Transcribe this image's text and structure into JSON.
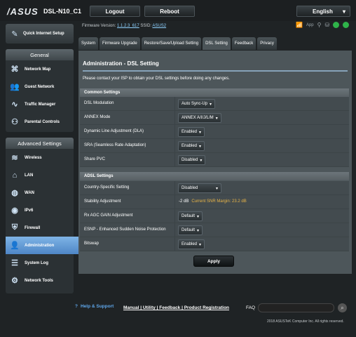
{
  "header": {
    "logo": "/ASUS",
    "model": "DSL-N10_C1",
    "logout_label": "Logout",
    "reboot_label": "Reboot",
    "language": "English"
  },
  "info_bar": {
    "firmware_label": "Firmware Version:",
    "firmware_value": "1.1.2.3_617",
    "ssid_label": "SSID:",
    "ssid_value": "ASUS2",
    "app_label": "App"
  },
  "sidebar": {
    "quick_setup": "Quick Internet Setup",
    "general_title": "General",
    "general_items": [
      {
        "label": "Network Map",
        "icon": "network-map-icon"
      },
      {
        "label": "Guest Network",
        "icon": "guest-network-icon"
      },
      {
        "label": "Traffic Manager",
        "icon": "traffic-manager-icon"
      },
      {
        "label": "Parental Controls",
        "icon": "parental-controls-icon"
      }
    ],
    "advanced_title": "Advanced Settings",
    "advanced_items": [
      {
        "label": "Wireless",
        "icon": "wireless-icon"
      },
      {
        "label": "LAN",
        "icon": "lan-icon"
      },
      {
        "label": "WAN",
        "icon": "wan-icon"
      },
      {
        "label": "IPv6",
        "icon": "ipv6-icon"
      },
      {
        "label": "Firewall",
        "icon": "firewall-icon"
      },
      {
        "label": "Administration",
        "icon": "administration-icon"
      },
      {
        "label": "System Log",
        "icon": "system-log-icon"
      },
      {
        "label": "Network Tools",
        "icon": "network-tools-icon"
      }
    ]
  },
  "tabs": [
    "System",
    "Firmware Upgrade",
    "Restore/Save/Upload Setting",
    "DSL Setting",
    "Feedback",
    "Privacy"
  ],
  "main": {
    "title": "Administration - DSL Setting",
    "description": "Please contact your ISP to obtain your DSL settings before doing any changes.",
    "common_header": "Common Settings",
    "common_rows": [
      {
        "label": "DSL Modulation",
        "value": "Auto Sync-Up"
      },
      {
        "label": "ANNEX Mode",
        "value": "ANNEX A/I/J/L/M"
      },
      {
        "label": "Dynamic Line Adjustment (DLA)",
        "value": "Enabled"
      },
      {
        "label": "SRA (Seamless Rate Adaptation)",
        "value": "Enabled"
      },
      {
        "label": "Share PVC",
        "value": "Disabled"
      }
    ],
    "adsl_header": "ADSL Settings",
    "adsl_rows": [
      {
        "label": "Country-Specific Setting",
        "value": "Disabled"
      },
      {
        "label": "Stability Adjustment",
        "value": "-2 dB",
        "note": "Current SNR Margin: 23.2 dB"
      },
      {
        "label": "Rx AGC GAIN Adjustment",
        "value": "Default"
      },
      {
        "label": "ESNP - Enhanced Sudden Noise Protection",
        "value": "Default"
      },
      {
        "label": "Bitswap",
        "value": "Enabled"
      }
    ],
    "apply_label": "Apply"
  },
  "footer": {
    "help": "Help & Support",
    "links": "Manual | Utility | Feedback | Product Registration",
    "faq_label": "FAQ",
    "copyright": "2018 ASUSTeK Computer Inc. All rights reserved."
  }
}
